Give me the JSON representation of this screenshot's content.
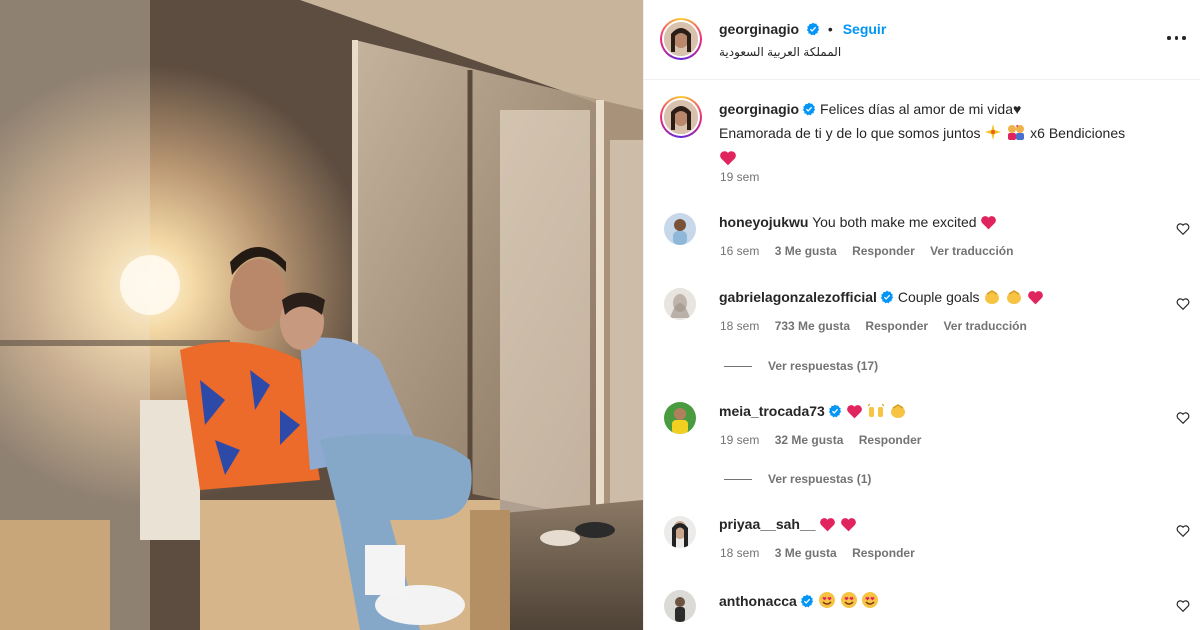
{
  "post": {
    "username": "georginagio",
    "follow_label": "Seguir",
    "separator": "•",
    "location": "المملكة العربية السعودية",
    "caption_line1": "Felices días al amor de mi vida♥",
    "caption_line2": "Enamorada de ti y de lo que somos juntos",
    "caption_line2b": "x6 Bendiciones",
    "caption_time": "19 sem"
  },
  "comments": [
    {
      "user": "honeyojukwu",
      "verified": false,
      "text": "You both make me excited",
      "time": "16 sem",
      "likes": "3 Me gusta",
      "reply": "Responder",
      "translate": "Ver traducción"
    },
    {
      "user": "gabrielagonzalezofficial",
      "verified": true,
      "text": "Couple goals",
      "time": "18 sem",
      "likes": "733 Me gusta",
      "reply": "Responder",
      "translate": "Ver traducción",
      "view_replies": "Ver respuestas (17)"
    },
    {
      "user": "meia_trocada73",
      "verified": true,
      "text": "",
      "time": "19 sem",
      "likes": "32 Me gusta",
      "reply": "Responder",
      "view_replies": "Ver respuestas (1)"
    },
    {
      "user": "priyaa__sah__",
      "verified": false,
      "text": "",
      "time": "18 sem",
      "likes": "3 Me gusta",
      "reply": "Responder"
    },
    {
      "user": "anthonacca",
      "verified": true,
      "text": ""
    }
  ],
  "icons": {
    "verified": "verified-badge-icon",
    "more": "more-options-icon",
    "like": "heart-outline-icon"
  },
  "colors": {
    "link": "#0095f6",
    "secondary": "#737373",
    "verified": "#0095f6",
    "heart": "#e0245e"
  }
}
